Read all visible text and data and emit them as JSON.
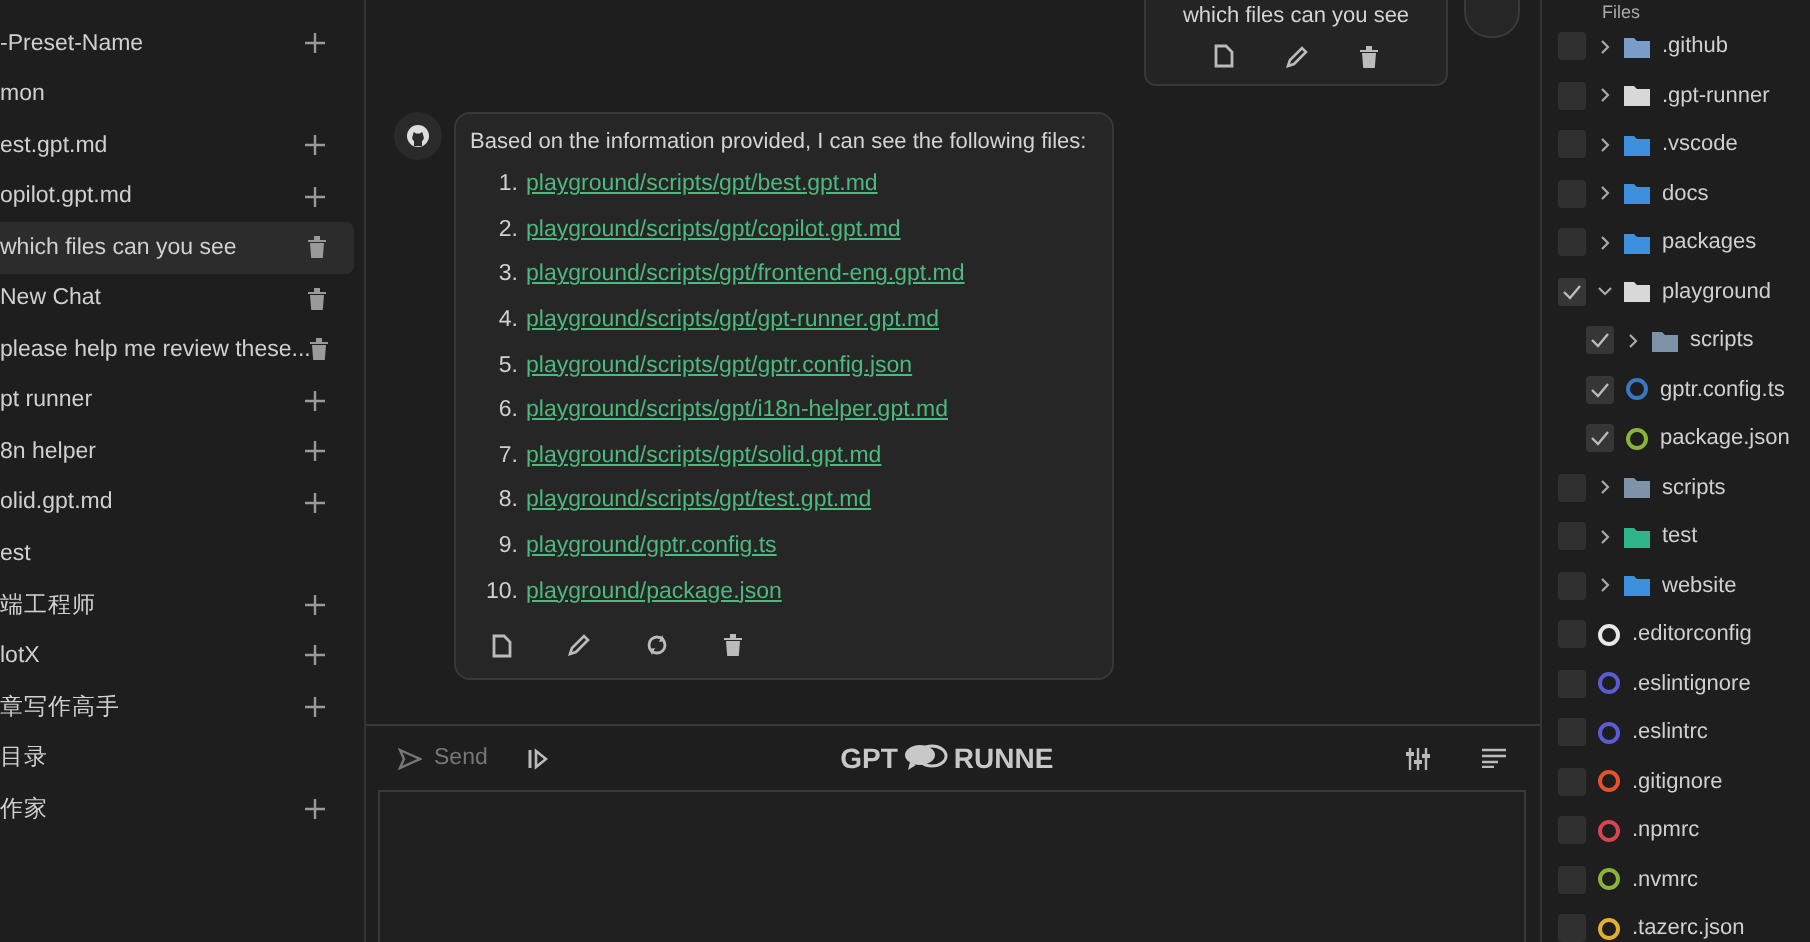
{
  "sidebar": {
    "items": [
      {
        "label": "-Preset-Name",
        "kind": "preset",
        "selected": false
      },
      {
        "label": "mon",
        "kind": "group",
        "selected": false
      },
      {
        "label": "est.gpt.md",
        "kind": "preset",
        "selected": false
      },
      {
        "label": "opilot.gpt.md",
        "kind": "preset",
        "selected": false
      },
      {
        "label": "which files can you see",
        "kind": "chat",
        "selected": true
      },
      {
        "label": "New Chat",
        "kind": "chat",
        "selected": false
      },
      {
        "label": "please help me review these...",
        "kind": "chat",
        "selected": false
      },
      {
        "label": "pt runner",
        "kind": "preset",
        "selected": false
      },
      {
        "label": "8n helper",
        "kind": "preset",
        "selected": false
      },
      {
        "label": "olid.gpt.md",
        "kind": "preset",
        "selected": false
      },
      {
        "label": "est",
        "kind": "group",
        "selected": false
      },
      {
        "label": "端工程师",
        "kind": "preset",
        "selected": false
      },
      {
        "label": "lotX",
        "kind": "preset",
        "selected": false
      },
      {
        "label": "章写作高手",
        "kind": "preset",
        "selected": false
      },
      {
        "label": "目录",
        "kind": "group",
        "selected": false
      },
      {
        "label": "作家",
        "kind": "preset",
        "selected": false
      }
    ]
  },
  "chat": {
    "user_message": {
      "text": "which files can you see"
    },
    "reply": {
      "intro": "Based on the information provided, I can see the following files:",
      "files": [
        {
          "number": "1.",
          "path": "playground/scripts/gpt/best.gpt.md"
        },
        {
          "number": "2.",
          "path": "playground/scripts/gpt/copilot.gpt.md"
        },
        {
          "number": "3.",
          "path": "playground/scripts/gpt/frontend-eng.gpt.md"
        },
        {
          "number": "4.",
          "path": "playground/scripts/gpt/gpt-runner.gpt.md"
        },
        {
          "number": "5.",
          "path": "playground/scripts/gpt/gptr.config.json"
        },
        {
          "number": "6.",
          "path": "playground/scripts/gpt/i18n-helper.gpt.md"
        },
        {
          "number": "7.",
          "path": "playground/scripts/gpt/solid.gpt.md"
        },
        {
          "number": "8.",
          "path": "playground/scripts/gpt/test.gpt.md"
        },
        {
          "number": "9.",
          "path": "playground/gptr.config.ts"
        },
        {
          "number": "10.",
          "path": "playground/package.json"
        }
      ]
    }
  },
  "composer": {
    "send_label": "Send",
    "send_disabled": true,
    "logo": {
      "left": "GPT",
      "right": "RUNNE"
    }
  },
  "file_tree": {
    "tab": "Files",
    "items": [
      {
        "name": ".github",
        "kind": "folder",
        "expanded": false,
        "checked": false,
        "color": "#7a9cc8"
      },
      {
        "name": ".gpt-runner",
        "kind": "folder",
        "expanded": false,
        "checked": false,
        "color": "#d8d8d8"
      },
      {
        "name": ".vscode",
        "kind": "folder",
        "expanded": false,
        "checked": false,
        "color": "#3d8fe0"
      },
      {
        "name": "docs",
        "kind": "folder",
        "expanded": false,
        "checked": false,
        "color": "#3d8fe0"
      },
      {
        "name": "packages",
        "kind": "folder",
        "expanded": false,
        "checked": false,
        "color": "#3d8fe0"
      },
      {
        "name": "playground",
        "kind": "folder",
        "expanded": true,
        "checked": true,
        "color": "#d8d8d8",
        "children": [
          {
            "name": "scripts",
            "kind": "folder",
            "expanded": false,
            "checked": true,
            "color": "#7f93a8"
          },
          {
            "name": "gptr.config.ts",
            "kind": "file",
            "checked": true,
            "color": "#3a78c4"
          },
          {
            "name": "package.json",
            "kind": "file",
            "checked": true,
            "color": "#8bb33a"
          }
        ]
      },
      {
        "name": "scripts",
        "kind": "folder",
        "expanded": false,
        "checked": false,
        "color": "#7f93a8"
      },
      {
        "name": "test",
        "kind": "folder",
        "expanded": false,
        "checked": false,
        "color": "#2fb58a"
      },
      {
        "name": "website",
        "kind": "folder",
        "expanded": false,
        "checked": false,
        "color": "#3d8fe0"
      },
      {
        "name": ".editorconfig",
        "kind": "file",
        "checked": false,
        "color": "#e8e8e8"
      },
      {
        "name": ".eslintignore",
        "kind": "file",
        "checked": false,
        "color": "#5b5bd6"
      },
      {
        "name": ".eslintrc",
        "kind": "file",
        "checked": false,
        "color": "#5b5bd6"
      },
      {
        "name": ".gitignore",
        "kind": "file",
        "checked": false,
        "color": "#e5532d"
      },
      {
        "name": ".npmrc",
        "kind": "file",
        "checked": false,
        "color": "#d94452"
      },
      {
        "name": ".nvmrc",
        "kind": "file",
        "checked": false,
        "color": "#8bb33a"
      },
      {
        "name": ".tazerc.json",
        "kind": "file",
        "checked": false,
        "color": "#e0b030"
      }
    ]
  }
}
